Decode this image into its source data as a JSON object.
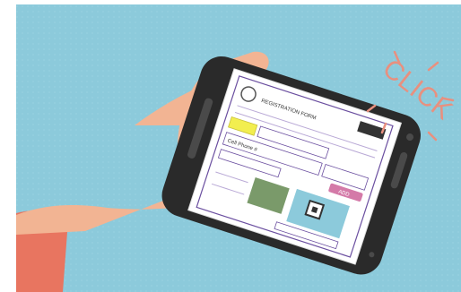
{
  "scene": {
    "onomatopoeia": "CLICK",
    "colors": {
      "background": "#8ccadb",
      "skin": "#f2b493",
      "sleeve": "#e87560",
      "phone_body": "#2a2a2a",
      "screen_paper": "#ffffff",
      "form_accent": "#6b4fa0",
      "highlight": "#f2ee4f",
      "click_text": "#e8907f"
    }
  },
  "form": {
    "heading": "REGISTRATION FORM",
    "field_label": "Cell Phone #",
    "button_label": "ADD"
  }
}
